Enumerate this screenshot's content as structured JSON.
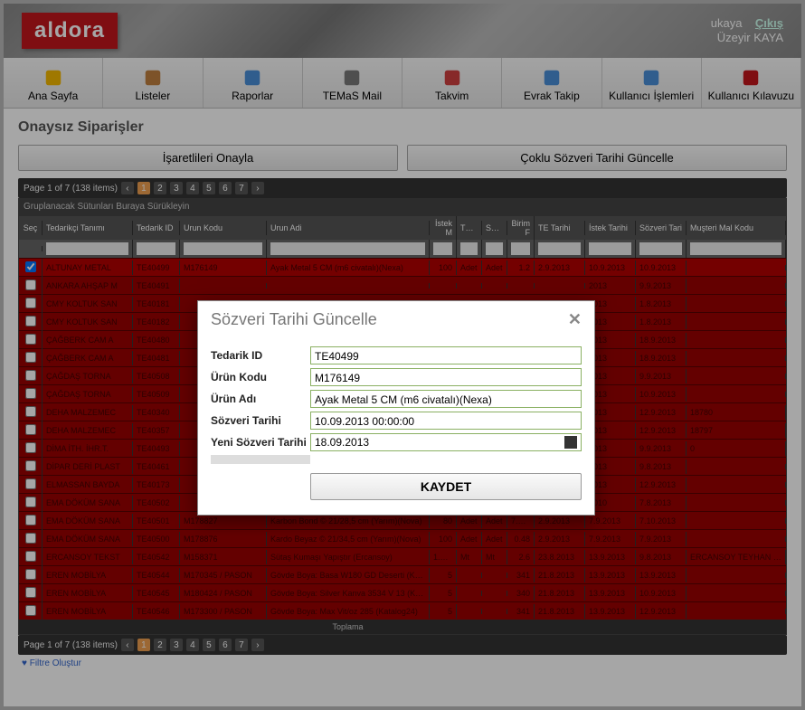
{
  "brand": "aldora",
  "user": {
    "welcome": "ukaya",
    "logout": "Çıkış",
    "name": "Üzeyir KAYA"
  },
  "nav": [
    {
      "label": "Ana Sayfa",
      "icon": "home"
    },
    {
      "label": "Listeler",
      "icon": "list"
    },
    {
      "label": "Raporlar",
      "icon": "chart"
    },
    {
      "label": "TEMaS Mail",
      "icon": "mail"
    },
    {
      "label": "Takvim",
      "icon": "calendar"
    },
    {
      "label": "Evrak Takip",
      "icon": "doc"
    },
    {
      "label": "Kullanıcı İşlemleri",
      "icon": "user"
    },
    {
      "label": "Kullanıcı Kılavuzu",
      "icon": "pdf"
    }
  ],
  "page_title": "Onaysız Siparişler",
  "buttons": {
    "approve": "İşaretlileri Onayla",
    "bulk_update": "Çoklu Sözveri Tarihi Güncelle"
  },
  "pager": {
    "summary": "Page 1 of 7 (138 items)",
    "pages": [
      "1",
      "2",
      "3",
      "4",
      "5",
      "6",
      "7"
    ],
    "active": 1
  },
  "group_hint": "Gruplanacak Sütunları Buraya Sürükleyin",
  "columns": [
    "Seç",
    "Tedarikçi Tanımı",
    "Tedarik ID",
    "Urun Kodu",
    "Urun Adi",
    "İstek M",
    "TE_S",
    "Satın",
    "Birim F",
    "TE Tarihi",
    "İstek Tarihi",
    "Sözveri Tari",
    "Muşteri Mal Kodu"
  ],
  "rows": [
    {
      "checked": true,
      "tedarikci": "ALTUNAY METAL",
      "tid": "TE40499",
      "ukodu": "M176149",
      "uadi": "Ayak Metal 5 CM (m6 civatalı)(Nexa)",
      "istekm": "100",
      "te": "Adet",
      "sat": "Adet",
      "birim": "1.2",
      "ttar": "2.9.2013",
      "itar": "10.9.2013",
      "star": "10.9.2013",
      "mkod": ""
    },
    {
      "checked": false,
      "tedarikci": "ANKARA AHŞAP M",
      "tid": "TE40491",
      "ukodu": "",
      "uadi": "",
      "istekm": "",
      "te": "",
      "sat": "",
      "birim": "",
      "ttar": "",
      "itar": "2013",
      "star": "9.9.2013",
      "mkod": ""
    },
    {
      "checked": false,
      "tedarikci": "CMY KOLTUK SAN",
      "tid": "TE40181",
      "ukodu": "",
      "uadi": "",
      "istekm": "",
      "te": "",
      "sat": "",
      "birim": "",
      "ttar": "",
      "itar": "2013",
      "star": "1.8.2013",
      "mkod": ""
    },
    {
      "checked": false,
      "tedarikci": "CMY KOLTUK SAN",
      "tid": "TE40182",
      "ukodu": "",
      "uadi": "",
      "istekm": "",
      "te": "",
      "sat": "",
      "birim": "",
      "ttar": "",
      "itar": "2013",
      "star": "1.8.2013",
      "mkod": ""
    },
    {
      "checked": false,
      "tedarikci": "ÇAĞBERK CAM A",
      "tid": "TE40480",
      "ukodu": "",
      "uadi": "",
      "istekm": "",
      "te": "",
      "sat": "",
      "birim": "",
      "ttar": "",
      "itar": "2013",
      "star": "18.9.2013",
      "mkod": ""
    },
    {
      "checked": false,
      "tedarikci": "ÇAĞBERK CAM A",
      "tid": "TE40481",
      "ukodu": "",
      "uadi": "",
      "istekm": "",
      "te": "",
      "sat": "",
      "birim": "",
      "ttar": "",
      "itar": "2013",
      "star": "18.9.2013",
      "mkod": ""
    },
    {
      "checked": false,
      "tedarikci": "ÇAĞDAŞ TORNA",
      "tid": "TE40508",
      "ukodu": "",
      "uadi": "",
      "istekm": "",
      "te": "",
      "sat": "",
      "birim": "",
      "ttar": "",
      "itar": "2013",
      "star": "9.9.2013",
      "mkod": ""
    },
    {
      "checked": false,
      "tedarikci": "ÇAĞDAŞ TORNA",
      "tid": "TE40509",
      "ukodu": "",
      "uadi": "",
      "istekm": "",
      "te": "",
      "sat": "",
      "birim": "",
      "ttar": "",
      "itar": "2013",
      "star": "10.9.2013",
      "mkod": ""
    },
    {
      "checked": false,
      "tedarikci": "DEHA MALZEMEC",
      "tid": "TE40340",
      "ukodu": "",
      "uadi": "",
      "istekm": "",
      "te": "",
      "sat": "",
      "birim": "",
      "ttar": "",
      "itar": "2013",
      "star": "12.9.2013",
      "mkod": "18780"
    },
    {
      "checked": false,
      "tedarikci": "DEHA MALZEMEC",
      "tid": "TE40357",
      "ukodu": "",
      "uadi": "",
      "istekm": "",
      "te": "",
      "sat": "",
      "birim": "",
      "ttar": "",
      "itar": "2013",
      "star": "12.9.2013",
      "mkod": "18797"
    },
    {
      "checked": false,
      "tedarikci": "DİMA İTH. İHR.T.",
      "tid": "TE40493",
      "ukodu": "",
      "uadi": "",
      "istekm": "",
      "te": "",
      "sat": "",
      "birim": "",
      "ttar": "",
      "itar": "2013",
      "star": "9.9.2013",
      "mkod": "0"
    },
    {
      "checked": false,
      "tedarikci": "DİPAR DERİ PLAST",
      "tid": "TE40461",
      "ukodu": "",
      "uadi": "",
      "istekm": "",
      "te": "",
      "sat": "",
      "birim": "",
      "ttar": "",
      "itar": "2013",
      "star": "9.8.2013",
      "mkod": ""
    },
    {
      "checked": false,
      "tedarikci": "ELMASSAN BAYDA",
      "tid": "TE40173",
      "ukodu": "",
      "uadi": "",
      "istekm": "",
      "te": "",
      "sat": "",
      "birim": "",
      "ttar": "",
      "itar": "2013",
      "star": "12.9.2013",
      "mkod": ""
    },
    {
      "checked": false,
      "tedarikci": "EMA DÖKÜM SANA",
      "tid": "TE40502",
      "ukodu": "",
      "uadi": "",
      "istekm": "",
      "te": "",
      "sat": "",
      "birim": "",
      "ttar": "",
      "itar": "2010",
      "star": "7.8.2013",
      "mkod": ""
    },
    {
      "checked": false,
      "tedarikci": "EMA DÖKÜM SANA",
      "tid": "TE40501",
      "ukodu": "M178827",
      "uadi": "Karbon Bond © 21/28,5 cm (Yarım)(Nova)",
      "istekm": "80",
      "te": "Adet",
      "sat": "Adet",
      "birim": "7.574",
      "ttar": "2.9.2013",
      "itar": "7.9.2013",
      "star": "7.10.2013",
      "mkod": ""
    },
    {
      "checked": false,
      "tedarikci": "EMA DÖKÜM SANA",
      "tid": "TE40500",
      "ukodu": "M178876",
      "uadi": "Kardo Beyaz © 21/34,5 cm (Yarım)(Nova)",
      "istekm": "100",
      "te": "Adet",
      "sat": "Adet",
      "birim": "0.48",
      "ttar": "2.9.2013",
      "itar": "7.9.2013",
      "star": "7.9.2013",
      "mkod": ""
    },
    {
      "checked": false,
      "tedarikci": "ERCANSOY TEKST",
      "tid": "TE40542",
      "ukodu": "M158371",
      "uadi": "Sütaş Kumaşı Yapıştır (Ercansoy)",
      "istekm": "1.200",
      "te": "Mt",
      "sat": "Mt",
      "birim": "2.6",
      "ttar": "23.8.2013",
      "itar": "13.9.2013",
      "star": "9.8.2013",
      "mkod": "ERCANSOY TEYHAN KUMAŞ"
    },
    {
      "checked": false,
      "tedarikci": "EREN MOBİLYA",
      "tid": "TE40544",
      "ukodu": "M170345 / PASON",
      "uadi": "Gövde Boya: Basa W180 GD Deserti (Katalog)",
      "istekm": "5",
      "te": "",
      "sat": "",
      "birim": "341",
      "ttar": "21.8.2013",
      "itar": "13.9.2013",
      "star": "13.9.2013",
      "mkod": ""
    },
    {
      "checked": false,
      "tedarikci": "EREN MOBİLYA",
      "tid": "TE40545",
      "ukodu": "M180424 / PASON",
      "uadi": "Gövde Boya: Silver Kanva 3534 V 13 (KT103)",
      "istekm": "5",
      "te": "",
      "sat": "",
      "birim": "340",
      "ttar": "21.8.2013",
      "itar": "13.9.2013",
      "star": "10.9.2013",
      "mkod": ""
    },
    {
      "checked": false,
      "tedarikci": "EREN MOBİLYA",
      "tid": "TE40546",
      "ukodu": "M173300 / PASON",
      "uadi": "Gövde Boya: Max Vit/oz 285 (Katalog24)",
      "istekm": "5",
      "te": "",
      "sat": "",
      "birim": "341",
      "ttar": "21.8.2013",
      "itar": "13.9.2013",
      "star": "12.9.2013",
      "mkod": ""
    }
  ],
  "grid_footer": "Toplama",
  "filter_builder": "Filtre Oluştur",
  "dialog": {
    "title": "Sözveri Tarihi Güncelle",
    "fields": {
      "tedarik_id_label": "Tedarik ID",
      "tedarik_id": "TE40499",
      "urun_kodu_label": "Ürün Kodu",
      "urun_kodu": "M176149",
      "urun_adi_label": "Ürün Adı",
      "urun_adi": "Ayak Metal 5 CM (m6 civatalı)(Nexa)",
      "sozveri_label": "Sözveri Tarihi",
      "sozveri": "10.09.2013 00:00:00",
      "yeni_label": "Yeni Sözveri Tarihi",
      "yeni": "18.09.2013"
    },
    "save": "KAYDET"
  }
}
